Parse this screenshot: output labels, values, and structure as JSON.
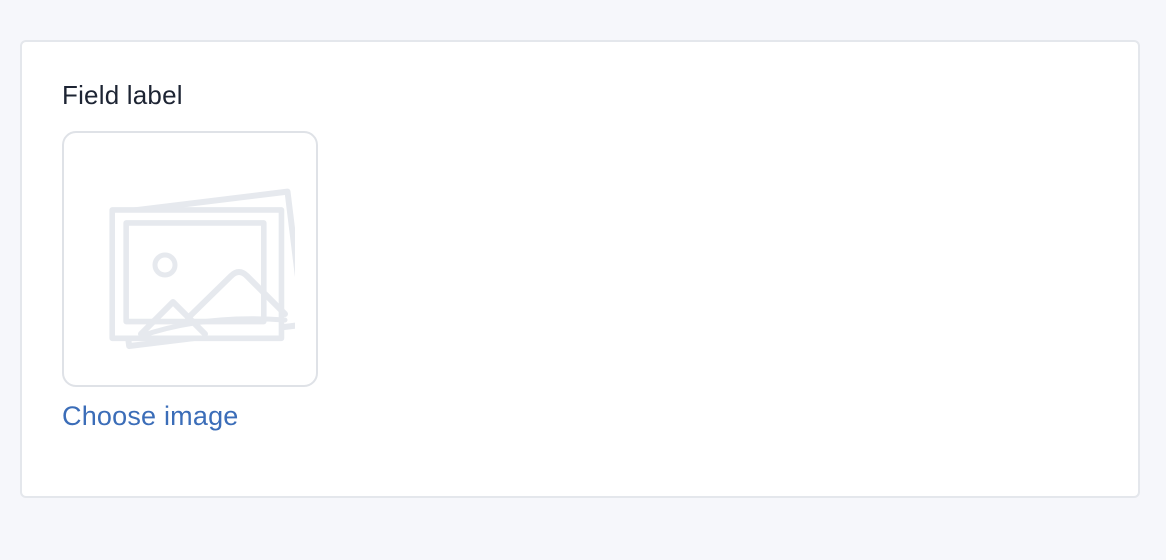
{
  "field": {
    "label": "Field label",
    "placeholder_icon": "image-placeholder-icon",
    "action_label": "Choose image"
  },
  "colors": {
    "background": "#f6f7fb",
    "card": "#ffffff",
    "card_border": "#e4e7ec",
    "label_text": "#1d2433",
    "link": "#3b6db8",
    "placeholder_icon": "#e6e9ee"
  }
}
